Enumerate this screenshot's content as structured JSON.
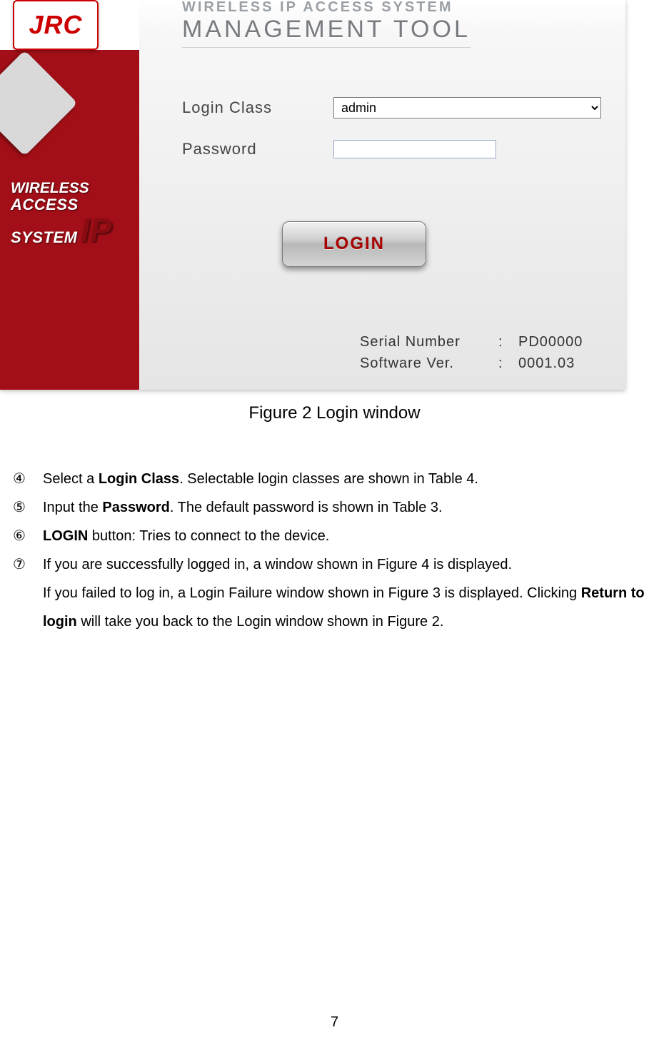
{
  "logo": "JRC",
  "sidebar_tagline": {
    "line1": "WIRELESS",
    "line2": "ACCESS SYSTEM",
    "ip": "IP"
  },
  "header": {
    "subtitle": "WIRELESS IP ACCESS SYSTEM",
    "title": "MANAGEMENT TOOL"
  },
  "form": {
    "login_class_label": "Login Class",
    "login_class_value": "admin",
    "password_label": "Password",
    "password_value": ""
  },
  "login_button": "LOGIN",
  "info": {
    "serial_label": "Serial Number",
    "serial_value": "PD00000",
    "version_label": "Software Ver.",
    "version_value": "0001.03",
    "sep": ":"
  },
  "caption": "Figure 2 Login window",
  "steps": [
    {
      "marker": "④",
      "pre": "Select a ",
      "bold": "Login Class",
      "post": ". Selectable login classes are shown in Table 4."
    },
    {
      "marker": "⑤",
      "pre": "Input the ",
      "bold": "Password",
      "post": ". The default password is shown in Table 3."
    },
    {
      "marker": "⑥",
      "pre": "",
      "bold": "LOGIN",
      "post": " button: Tries to connect to the device."
    },
    {
      "marker": "⑦",
      "pre": "If you are successfully logged in, a window shown in Figure 4 is displayed.",
      "bold": "",
      "post": ""
    }
  ],
  "step_extra": {
    "pre": "If you failed to log in, a Login Failure window shown in Figure 3 is displayed. Clicking ",
    "bold": "Return to login",
    "post": " will take you back to the Login window shown in Figure 2."
  },
  "page_number": "7"
}
